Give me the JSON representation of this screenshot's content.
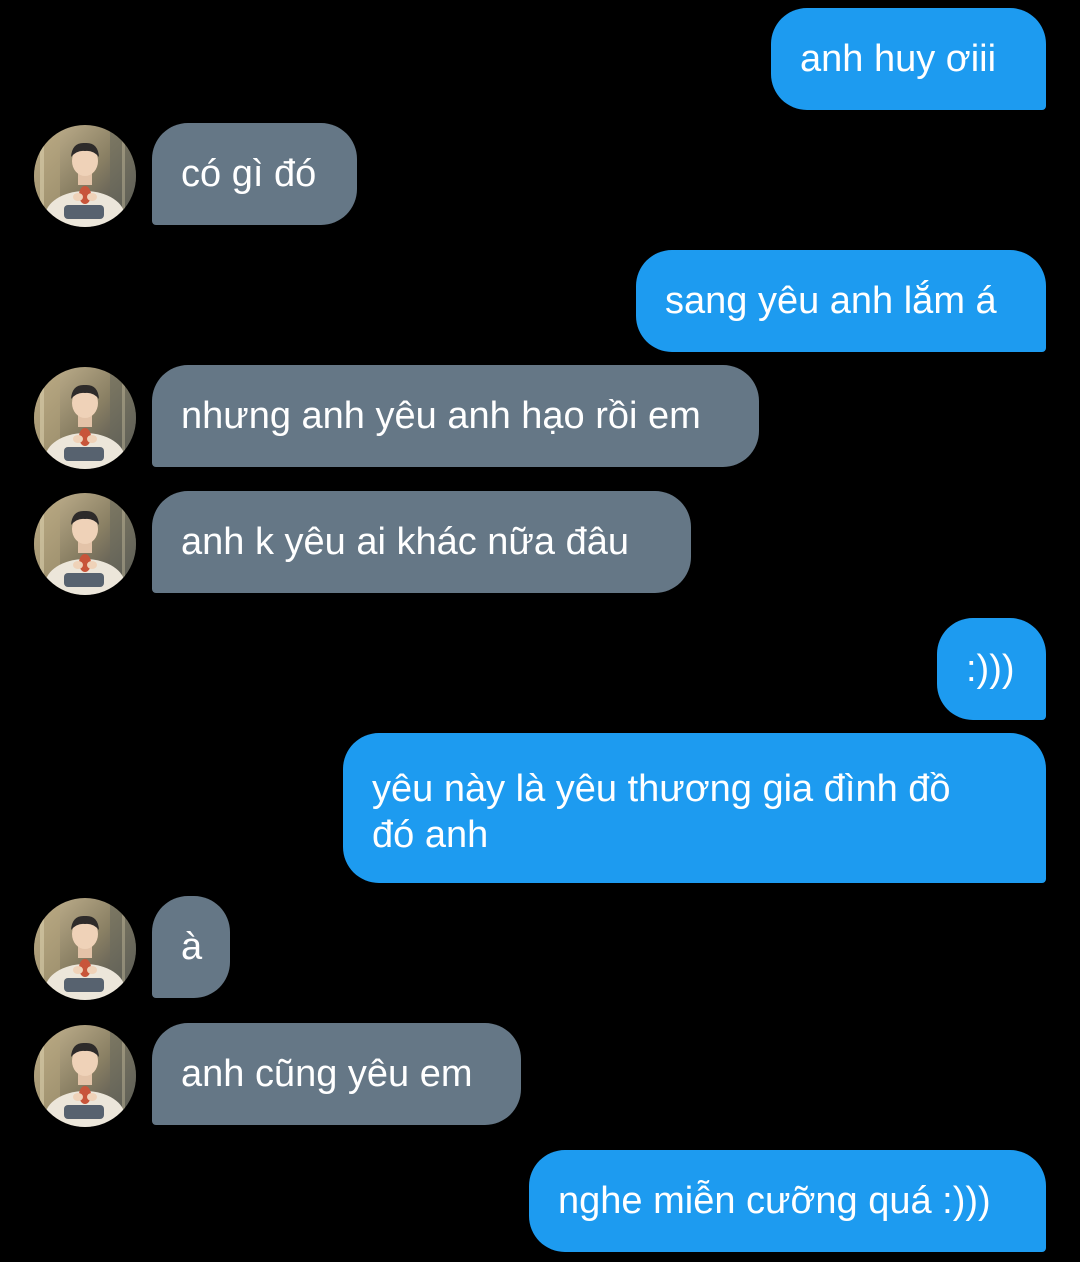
{
  "conversation": {
    "messages": [
      {
        "sender": "me",
        "text": "anh huy ơiii"
      },
      {
        "sender": "other",
        "text": "có gì đó"
      },
      {
        "sender": "me",
        "text": "sang yêu anh lắm á"
      },
      {
        "sender": "other",
        "text": "nhưng anh yêu anh hạo rồi em"
      },
      {
        "sender": "other",
        "text": "anh k yêu ai khác nữa đâu"
      },
      {
        "sender": "me",
        "text": ":)))"
      },
      {
        "sender": "me",
        "text": "yêu này là yêu thương gia đình đồ đó anh"
      },
      {
        "sender": "other",
        "text": "à"
      },
      {
        "sender": "other",
        "text": "anh cũng yêu em"
      },
      {
        "sender": "me",
        "text": "nghe miễn cưỡng quá :)))"
      }
    ]
  },
  "colors": {
    "background": "#000000",
    "sent_bubble": "#1d9bf0",
    "received_bubble": "#657786",
    "text": "#ffffff"
  },
  "icons": {
    "avatar": "contact-profile-photo"
  }
}
